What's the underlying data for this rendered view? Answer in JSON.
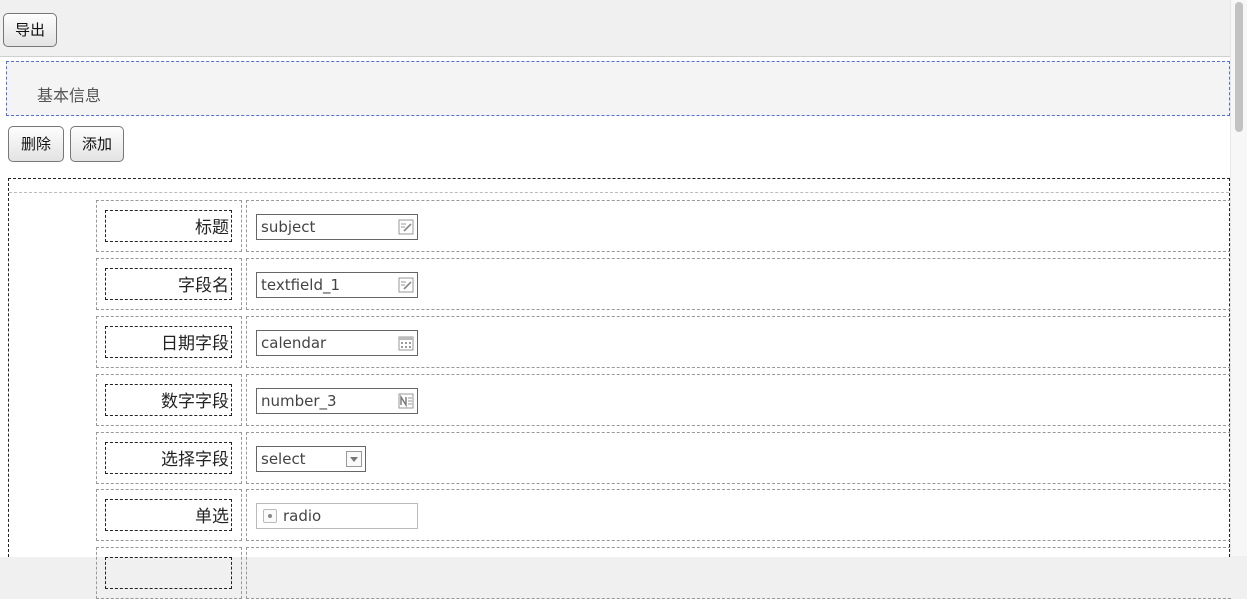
{
  "toolbar": {
    "export_label": "导出"
  },
  "section": {
    "title": "基本信息"
  },
  "actions": {
    "delete_label": "删除",
    "add_label": "添加"
  },
  "fields": [
    {
      "label": "标题",
      "value": "subject",
      "icon": "edit-icon"
    },
    {
      "label": "字段名",
      "value": "textfield_1",
      "icon": "edit-icon"
    },
    {
      "label": "日期字段",
      "value": "calendar",
      "icon": "calendar-icon"
    },
    {
      "label": "数字字段",
      "value": "number_3",
      "icon": "number-icon"
    },
    {
      "label": "选择字段",
      "value": "select",
      "icon": "dropdown-icon"
    },
    {
      "label": "单选",
      "value": "radio",
      "icon": "radio-icon"
    }
  ]
}
